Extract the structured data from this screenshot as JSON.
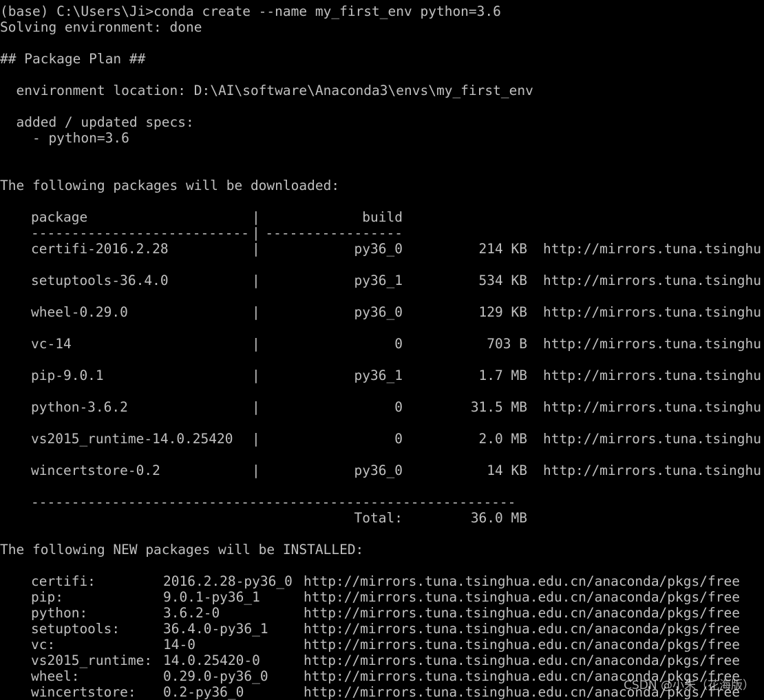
{
  "terminal": {
    "prompt_line": "(base) C:\\Users\\Ji>conda create --name my_first_env python=3.6",
    "solving_line": "Solving environment: done",
    "plan_heading": "## Package Plan ##",
    "env_location_line": "  environment location: D:\\AI\\software\\Anaconda3\\envs\\my_first_env",
    "specs_heading": "  added / updated specs:",
    "spec_line": "    - python=3.6",
    "download_heading": "The following packages will be downloaded:",
    "download_table": {
      "header_package": "package",
      "header_build": "build",
      "header_separator_left": "---------------------------",
      "header_pipe": "|",
      "header_separator_right": "-----------------",
      "rows": [
        {
          "package": "certifi-2016.2.28",
          "build": "py36_0",
          "size": "214 KB",
          "channel": "http://mirrors.tuna.tsinghu"
        },
        {
          "package": "setuptools-36.4.0",
          "build": "py36_1",
          "size": "534 KB",
          "channel": "http://mirrors.tuna.tsinghu"
        },
        {
          "package": "wheel-0.29.0",
          "build": "py36_0",
          "size": "129 KB",
          "channel": "http://mirrors.tuna.tsinghu"
        },
        {
          "package": "vc-14",
          "build": "0",
          "size": "703 B",
          "channel": "http://mirrors.tuna.tsinghu"
        },
        {
          "package": "pip-9.0.1",
          "build": "py36_1",
          "size": "1.7 MB",
          "channel": "http://mirrors.tuna.tsinghu"
        },
        {
          "package": "python-3.6.2",
          "build": "0",
          "size": "31.5 MB",
          "channel": "http://mirrors.tuna.tsinghu"
        },
        {
          "package": "vs2015_runtime-14.0.25420",
          "build": "0",
          "size": "2.0 MB",
          "channel": "http://mirrors.tuna.tsinghu"
        },
        {
          "package": "wincertstore-0.2",
          "build": "py36_0",
          "size": "14 KB",
          "channel": "http://mirrors.tuna.tsinghu"
        }
      ],
      "footer_separator": "------------------------------------------------------------",
      "total_label": "Total:",
      "total_value": "36.0 MB"
    },
    "installed_heading": "The following NEW packages will be INSTALLED:",
    "installed": [
      {
        "name": "certifi:",
        "version": "2016.2.28-py36_0",
        "channel": "http://mirrors.tuna.tsinghua.edu.cn/anaconda/pkgs/free"
      },
      {
        "name": "pip:",
        "version": "9.0.1-py36_1",
        "channel": "http://mirrors.tuna.tsinghua.edu.cn/anaconda/pkgs/free"
      },
      {
        "name": "python:",
        "version": "3.6.2-0",
        "channel": "http://mirrors.tuna.tsinghua.edu.cn/anaconda/pkgs/free"
      },
      {
        "name": "setuptools:",
        "version": "36.4.0-py36_1",
        "channel": "http://mirrors.tuna.tsinghua.edu.cn/anaconda/pkgs/free"
      },
      {
        "name": "vc:",
        "version": "14-0",
        "channel": "http://mirrors.tuna.tsinghua.edu.cn/anaconda/pkgs/free"
      },
      {
        "name": "vs2015_runtime:",
        "version": "14.0.25420-0",
        "channel": "http://mirrors.tuna.tsinghua.edu.cn/anaconda/pkgs/free"
      },
      {
        "name": "wheel:",
        "version": "0.29.0-py36_0",
        "channel": "http://mirrors.tuna.tsinghua.edu.cn/anaconda/pkgs/free"
      },
      {
        "name": "wincertstore:",
        "version": "0.2-py36_0",
        "channel": "http://mirrors.tuna.tsinghua.edu.cn/anaconda/pkgs/free"
      }
    ]
  },
  "watermark": "CSDN @小朱（花海版）",
  "colors": {
    "background": "#000000",
    "text": "#c0c0c0"
  }
}
